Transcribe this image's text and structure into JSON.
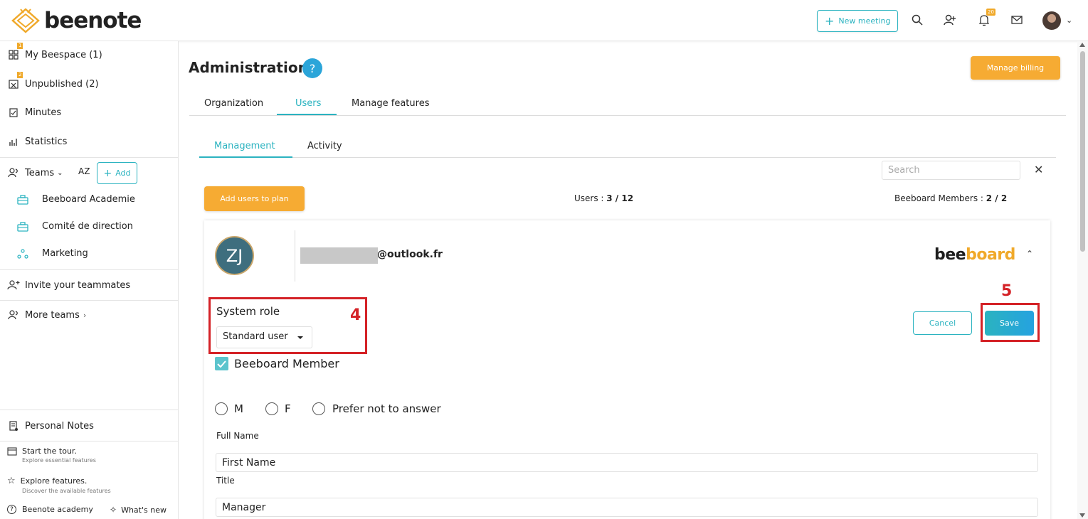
{
  "header": {
    "logo_text": "beenote",
    "new_meeting": "New meeting",
    "notif_count": "20"
  },
  "sidebar": {
    "my_beespace": "My Beespace (1)",
    "my_beespace_badge": "1",
    "unpublished": "Unpublished (2)",
    "unpublished_badge": "2",
    "minutes": "Minutes",
    "statistics": "Statistics",
    "teams": "Teams",
    "sort_label": "AZ",
    "add": "Add",
    "team_items": [
      "Beeboard Academie",
      "Comité de direction",
      "Marketing"
    ],
    "invite": "Invite your teammates",
    "more_teams": "More teams",
    "personal_notes": "Personal Notes",
    "tour_title": "Start the tour.",
    "tour_sub": "Explore essential features",
    "explore_title": "Explore features.",
    "explore_sub": "Discover the available features",
    "academy": "Beenote academy",
    "whats_new": "What's new"
  },
  "main": {
    "title": "Administration",
    "help": "?",
    "manage_billing": "Manage billing",
    "tabs": [
      "Organization",
      "Users",
      "Manage features"
    ],
    "subtabs": [
      "Management",
      "Activity"
    ],
    "search_placeholder": "Search",
    "add_users": "Add users to plan",
    "users_label": "Users : ",
    "users_value": "3 / 12",
    "members_label": "Beeboard Members : ",
    "members_value": "2 / 2"
  },
  "card": {
    "initials": "ZJ",
    "email": "@outlook.fr",
    "brand_dark": "bee",
    "brand_gold": "board",
    "system_role_label": "System role",
    "role_value": "Standard user",
    "cancel": "Cancel",
    "save": "Save",
    "member_label": "Beeboard Member",
    "member_checked": true,
    "gender_options": [
      "M",
      "F",
      "Prefer not to answer"
    ],
    "full_name_label": "Full Name",
    "first_name_placeholder": "First Name",
    "title_label": "Title",
    "title_value": "Manager"
  },
  "annotations": {
    "box4": "4",
    "box5": "5"
  },
  "colors": {
    "accent": "#2bb3c0",
    "orange": "#f6ab33",
    "annotation": "#d42227"
  }
}
